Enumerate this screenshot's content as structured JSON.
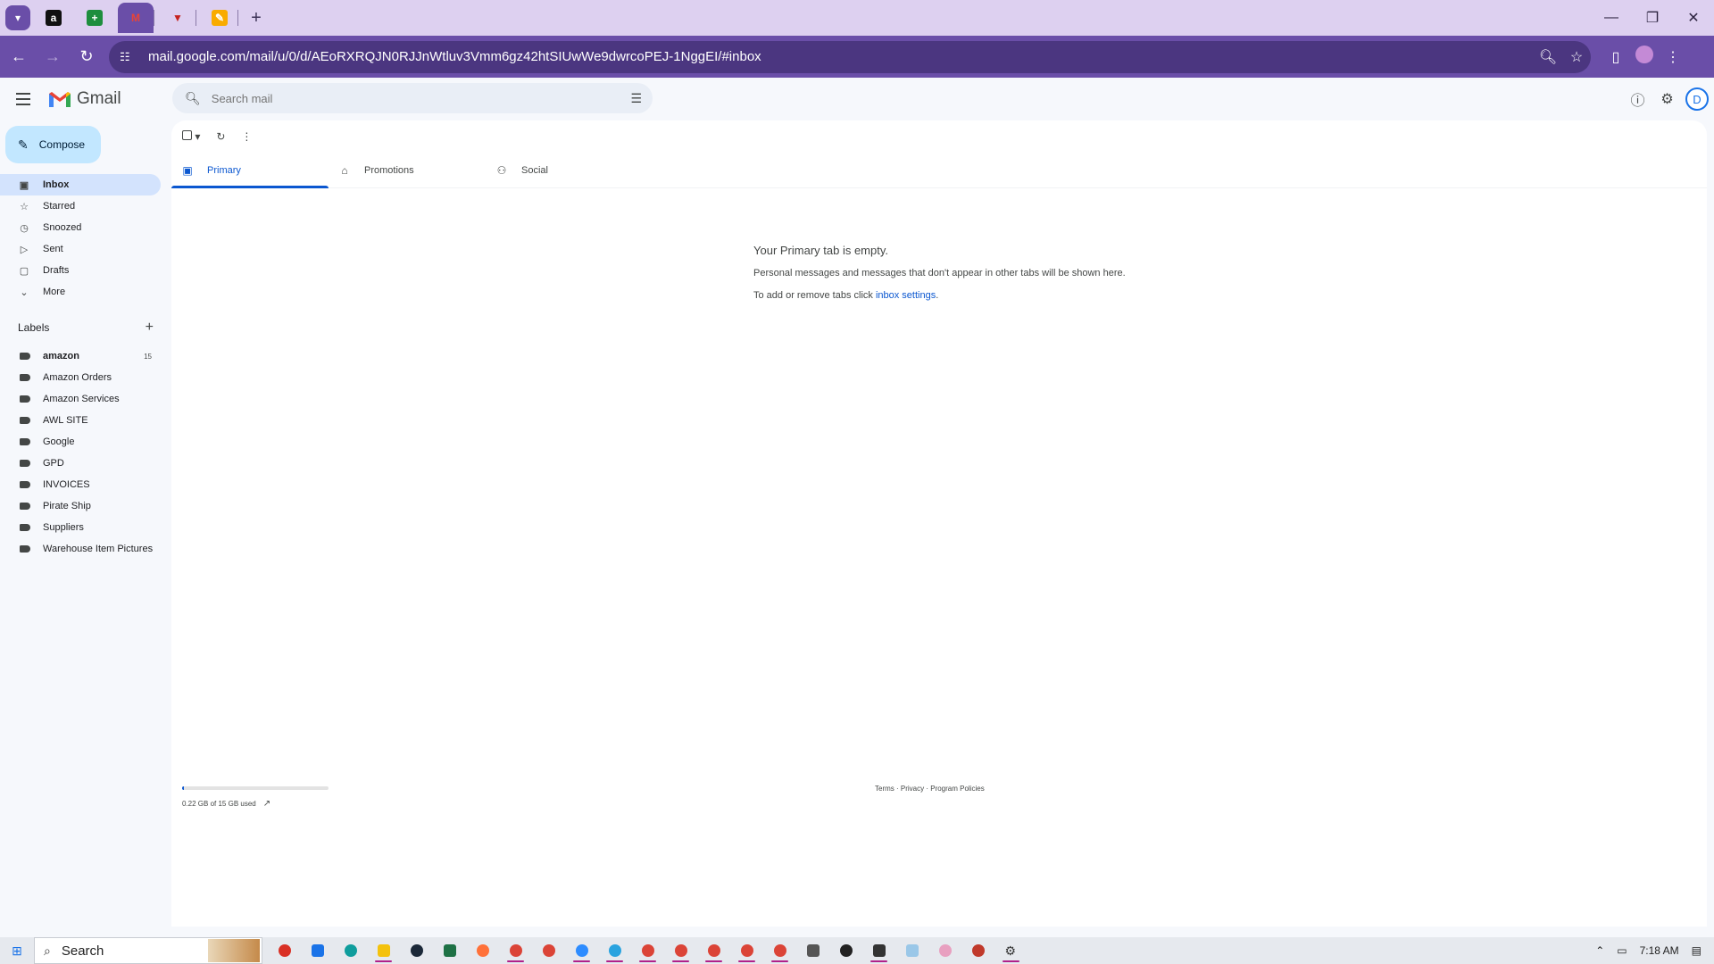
{
  "browser": {
    "url": "mail.google.com/mail/u/0/d/AEoRXRQJN0RJJnWtluv3Vmm6gz42htSIUwWe9dwrcoPEJ-1NggEI/#inbox"
  },
  "gmail": {
    "logo_text": "Gmail",
    "search_placeholder": "Search mail",
    "avatar_letter": "D"
  },
  "sidebar": {
    "compose_label": "Compose",
    "nav": [
      {
        "label": "Inbox",
        "icon": "inbox-icon"
      },
      {
        "label": "Starred",
        "icon": "star-icon"
      },
      {
        "label": "Snoozed",
        "icon": "clock-icon"
      },
      {
        "label": "Sent",
        "icon": "send-icon"
      },
      {
        "label": "Drafts",
        "icon": "draft-icon"
      },
      {
        "label": "More",
        "icon": "chevron-down-icon"
      }
    ],
    "labels_title": "Labels",
    "labels": [
      {
        "name": "amazon",
        "count": "15"
      },
      {
        "name": "Amazon Orders"
      },
      {
        "name": "Amazon Services"
      },
      {
        "name": "AWL SITE"
      },
      {
        "name": "Google"
      },
      {
        "name": "GPD"
      },
      {
        "name": "INVOICES"
      },
      {
        "name": "Pirate Ship"
      },
      {
        "name": "Suppliers"
      },
      {
        "name": "Warehouse Item Pictures"
      }
    ]
  },
  "main": {
    "tabs": [
      {
        "label": "Primary",
        "icon": "inbox-icon"
      },
      {
        "label": "Promotions",
        "icon": "tag-icon"
      },
      {
        "label": "Social",
        "icon": "people-icon"
      }
    ],
    "empty_title": "Your Primary tab is empty.",
    "empty_line1": "Personal messages and messages that don't appear in other tabs will be shown here.",
    "empty_line2_prefix": "To add or remove tabs click ",
    "empty_line2_link": "inbox settings",
    "empty_line2_suffix": ".",
    "storage_text": "0.22 GB of 15 GB used",
    "storage_fraction": 0.015,
    "footer": {
      "terms": "Terms",
      "privacy": "Privacy",
      "policies": "Program Policies",
      "sep": " · "
    }
  },
  "taskbar": {
    "search_label": "Search",
    "time": "7:18 AM"
  },
  "colors": {
    "chrome_purple": "#6a4ea8",
    "compose_bg": "#c2e7ff",
    "active_nav": "#d3e3fd",
    "accent_blue": "#0b57d0"
  }
}
